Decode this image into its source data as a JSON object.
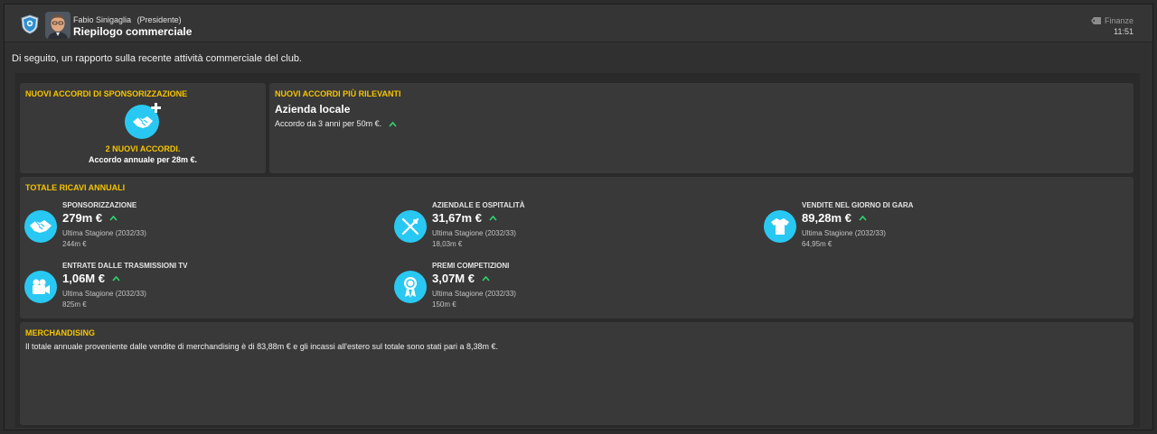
{
  "header": {
    "sender_name": "Fabio Sinigaglia",
    "sender_role": "(Presidente)",
    "subject": "Riepilogo commerciale",
    "category": "Finanze",
    "time": "11:51",
    "icons": [
      "club-badge-icon",
      "avatar",
      "tag-icon"
    ]
  },
  "intro": "Di seguito, un rapporto sulla recente attività commerciale del club.",
  "sponsorship_panel": {
    "title": "NUOVI ACCORDI DI SPONSORIZZAZIONE",
    "icon": "handshake-plus-icon",
    "new_deals": "2 NUOVI ACCORDI.",
    "annual": "Accordo annuale per 28m €."
  },
  "deals_panel": {
    "title": "NUOVI ACCORDI PIÙ RILEVANTI",
    "deal_name": "Azienda locale",
    "deal_desc": "Accordo da 3 anni per 50m €.",
    "trend": "up"
  },
  "revenue_panel": {
    "title": "TOTALE RICAVI ANNUALI",
    "items": [
      {
        "label": "SPONSORIZZAZIONE",
        "value": "279m €",
        "season": "Ultima Stagione (2032/33)",
        "previous": "244m €",
        "icon": "handshake-icon",
        "trend": "up"
      },
      {
        "label": "AZIENDALE E OSPITALITÀ",
        "value": "31,67m €",
        "season": "Ultima Stagione (2032/33)",
        "previous": "18,03m €",
        "icon": "cutlery-icon",
        "trend": "up"
      },
      {
        "label": "VENDITE NEL GIORNO DI GARA",
        "value": "89,28m €",
        "season": "Ultima Stagione (2032/33)",
        "previous": "64,95m €",
        "icon": "shirt-icon",
        "trend": "up"
      },
      {
        "label": "ENTRATE DALLE TRASMISSIONI TV",
        "value": "1,06M €",
        "season": "Ultima Stagione (2032/33)",
        "previous": "825m €",
        "icon": "video-camera-icon",
        "trend": "up"
      },
      {
        "label": "PREMI COMPETIZIONI",
        "value": "3,07M €",
        "season": "Ultima Stagione (2032/33)",
        "previous": "150m €",
        "icon": "medal-icon",
        "trend": "up"
      }
    ]
  },
  "merch_panel": {
    "title": "MERCHANDISING",
    "text": "Il totale annuale proveniente dalle vendite di merchandising è di 83,88m € e gli incassi all'estero sul totale sono stati pari a 8,38m €."
  },
  "colors": {
    "accent_yellow": "#f5c400",
    "icon_blue": "#29c8f2",
    "trend_green": "#2fd66b"
  }
}
